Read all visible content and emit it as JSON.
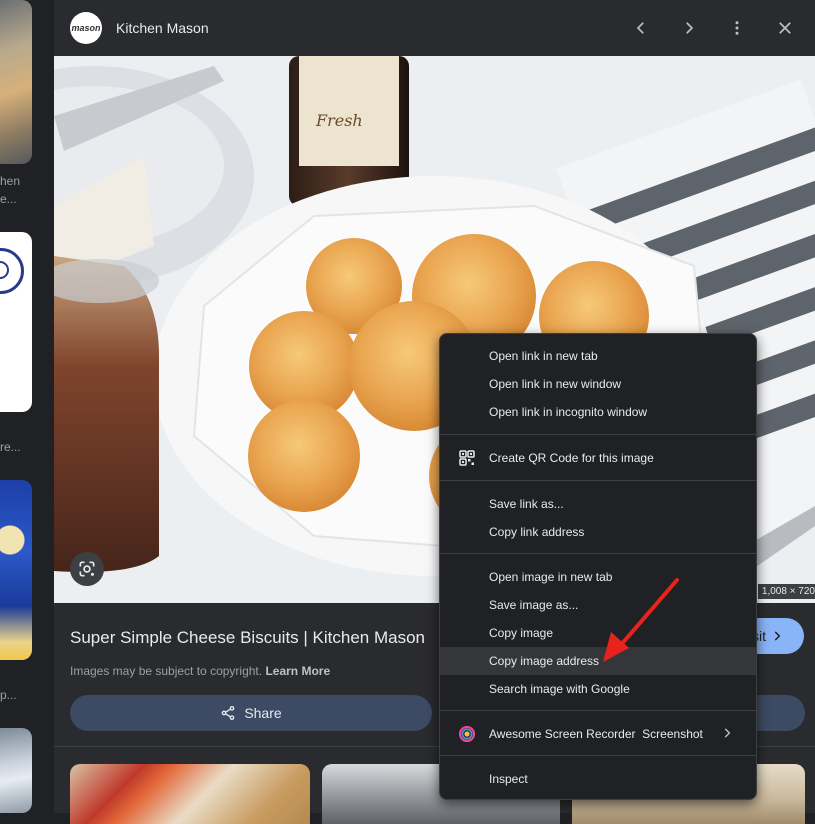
{
  "left_strip": {
    "text1": "hen",
    "text2": "e...",
    "text3": "re...",
    "text4": "p..."
  },
  "header": {
    "site_name": "Kitchen Mason",
    "site_icon_text": "mason",
    "prev_icon": "chevron-left-icon",
    "next_icon": "chevron-right-icon",
    "more_icon": "more-vert-icon",
    "close_icon": "close-icon"
  },
  "image": {
    "dimensions": "1,008 × 720"
  },
  "result": {
    "title": "Super Simple Cheese Biscuits | Kitchen Mason",
    "copyright": "Images may be subject to copyright.",
    "learn_more": "Learn More",
    "visit_label": "sit",
    "share_label": "Share"
  },
  "context_menu": {
    "items": [
      {
        "label": "Open link in new tab"
      },
      {
        "label": "Open link in new window"
      },
      {
        "label": "Open link in incognito window"
      },
      {
        "label": "Create QR Code for this image"
      },
      {
        "label": "Save link as..."
      },
      {
        "label": "Copy link address"
      },
      {
        "label": "Open image in new tab"
      },
      {
        "label": "Save image as..."
      },
      {
        "label": "Copy image"
      },
      {
        "label": "Copy image address"
      },
      {
        "label": "Search image with Google"
      },
      {
        "label": "Awesome Screen Recorder  Screenshot"
      },
      {
        "label": "Inspect"
      }
    ],
    "highlighted_item": "Copy image address"
  },
  "colors": {
    "accent": "#8ab4f8",
    "annotation_arrow": "#e8231b"
  }
}
